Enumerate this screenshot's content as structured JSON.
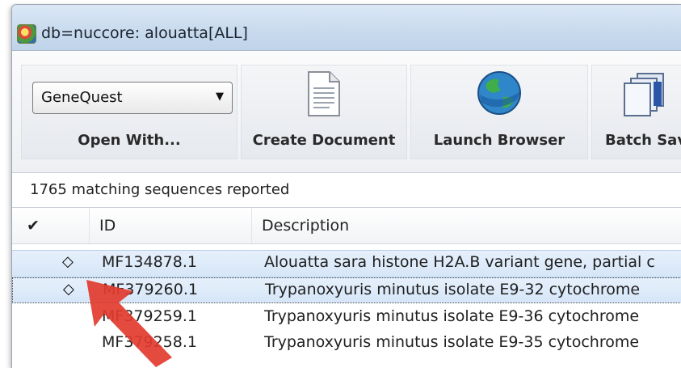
{
  "window": {
    "title": "db=nuccore: alouatta[ALL]",
    "app_icon": "sequence-app-icon"
  },
  "toolbar": {
    "opener": {
      "selected": "GeneQuest",
      "label": "Open With..."
    },
    "create_document": {
      "label": "Create Document",
      "icon": "document-icon"
    },
    "launch_browser": {
      "label": "Launch Browser",
      "icon": "globe-icon"
    },
    "batch_save": {
      "label": "Batch Sav",
      "icon": "batch-save-icon"
    }
  },
  "status": {
    "text": "1765 matching sequences reported"
  },
  "grid": {
    "columns": {
      "check": "✔",
      "id": "ID",
      "description": "Description"
    },
    "rows": [
      {
        "mark": "◇",
        "id": "MF134878.1",
        "description": "Alouatta sara histone H2A.B variant gene, partial c"
      },
      {
        "mark": "◇",
        "id": "MF379260.1",
        "description": "Trypanoxyuris minutus isolate E9-32 cytochrome"
      },
      {
        "mark": "",
        "id": "MF379259.1",
        "description": "Trypanoxyuris minutus isolate E9-36 cytochrome"
      },
      {
        "mark": "",
        "id": "MF379258.1",
        "description": "Trypanoxyuris minutus isolate E9-35 cytochrome"
      }
    ]
  },
  "colors": {
    "titlebar": "#cbdcef",
    "selection": "#d6e6f8",
    "pointer_arrow": "#e23b2e"
  }
}
